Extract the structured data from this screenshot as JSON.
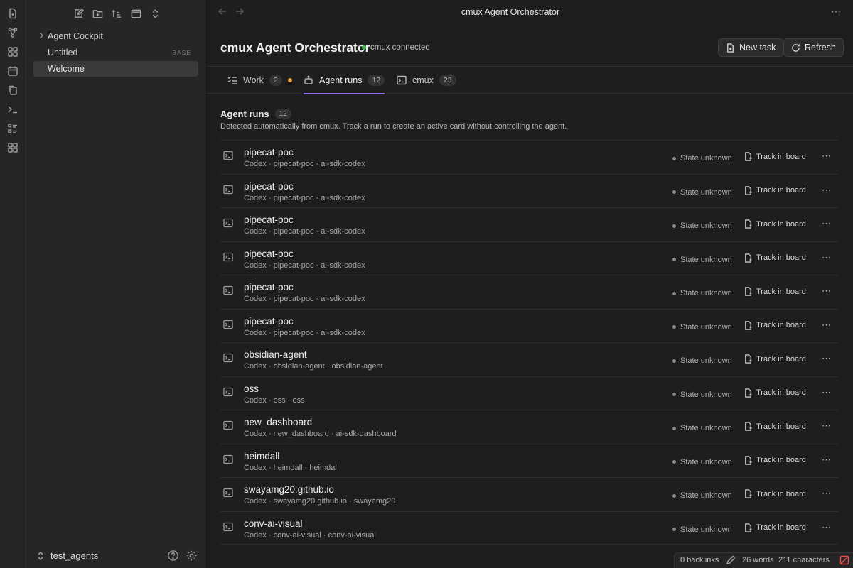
{
  "ribbon": {
    "icons": [
      "file-plus-icon",
      "graph-icon",
      "dashboard-icon",
      "calendar-icon",
      "copy-icon",
      "terminal-icon",
      "checklist-icon",
      "grid-icon"
    ]
  },
  "sidebar": {
    "toolbar_icons": [
      "new-note-icon",
      "new-folder-icon",
      "sort-icon",
      "collapse-icon",
      "expand-collapse-icon"
    ],
    "items": [
      {
        "label": "Agent Cockpit",
        "tag": "",
        "active": false,
        "folder": true
      },
      {
        "label": "Untitled",
        "tag": "BASE",
        "active": false,
        "folder": false
      },
      {
        "label": "Welcome",
        "tag": "",
        "active": true,
        "folder": false
      }
    ],
    "vault_name": "test_agents"
  },
  "titlebar": {
    "title": "cmux Agent Orchestrator",
    "more": "⋯"
  },
  "header": {
    "title": "cmux Agent Orchestrator",
    "connection_status": "cmux connected",
    "new_task_label": "New task",
    "refresh_label": "Refresh"
  },
  "tabs": [
    {
      "label": "Work",
      "count": "2",
      "icon": "checklist-icon",
      "active": false,
      "indicator": true
    },
    {
      "label": "Agent runs",
      "count": "12",
      "icon": "robot-icon",
      "active": true,
      "indicator": false
    },
    {
      "label": "cmux",
      "count": "23",
      "icon": "terminal-icon",
      "active": false,
      "indicator": false
    }
  ],
  "section": {
    "title": "Agent runs",
    "count": "12",
    "description": "Detected automatically from cmux. Track a run to create an active card without controlling the agent."
  },
  "runs": [
    {
      "name": "pipecat-poc",
      "meta": "Codex · pipecat-poc · ai-sdk-codex",
      "state": "State unknown",
      "action": "Track in board"
    },
    {
      "name": "pipecat-poc",
      "meta": "Codex · pipecat-poc · ai-sdk-codex",
      "state": "State unknown",
      "action": "Track in board"
    },
    {
      "name": "pipecat-poc",
      "meta": "Codex · pipecat-poc · ai-sdk-codex",
      "state": "State unknown",
      "action": "Track in board"
    },
    {
      "name": "pipecat-poc",
      "meta": "Codex · pipecat-poc · ai-sdk-codex",
      "state": "State unknown",
      "action": "Track in board"
    },
    {
      "name": "pipecat-poc",
      "meta": "Codex · pipecat-poc · ai-sdk-codex",
      "state": "State unknown",
      "action": "Track in board"
    },
    {
      "name": "pipecat-poc",
      "meta": "Codex · pipecat-poc · ai-sdk-codex",
      "state": "State unknown",
      "action": "Track in board"
    },
    {
      "name": "obsidian-agent",
      "meta": "Codex · obsidian-agent · obsidian-agent",
      "state": "State unknown",
      "action": "Track in board"
    },
    {
      "name": "oss",
      "meta": "Codex · oss · oss",
      "state": "State unknown",
      "action": "Track in board"
    },
    {
      "name": "new_dashboard",
      "meta": "Codex · new_dashboard · ai-sdk-dashboard",
      "state": "State unknown",
      "action": "Track in board"
    },
    {
      "name": "heimdall",
      "meta": "Codex · heimdall · heimdal",
      "state": "State unknown",
      "action": "Track in board"
    },
    {
      "name": "swayamg20.github.io",
      "meta": "Codex · swayamg20.github.io · swayamg20",
      "state": "State unknown",
      "action": "Track in board"
    },
    {
      "name": "conv-ai-visual",
      "meta": "Codex · conv-ai-visual · conv-ai-visual",
      "state": "State unknown",
      "action": "Track in board"
    }
  ],
  "statusbar": {
    "backlinks": "0 backlinks",
    "words": "26 words",
    "characters": "211 characters"
  },
  "colors": {
    "accent": "#8b6cf0",
    "connected": "#3fb950",
    "indicator": "#e8a33a",
    "sync_error": "#e5534b"
  }
}
